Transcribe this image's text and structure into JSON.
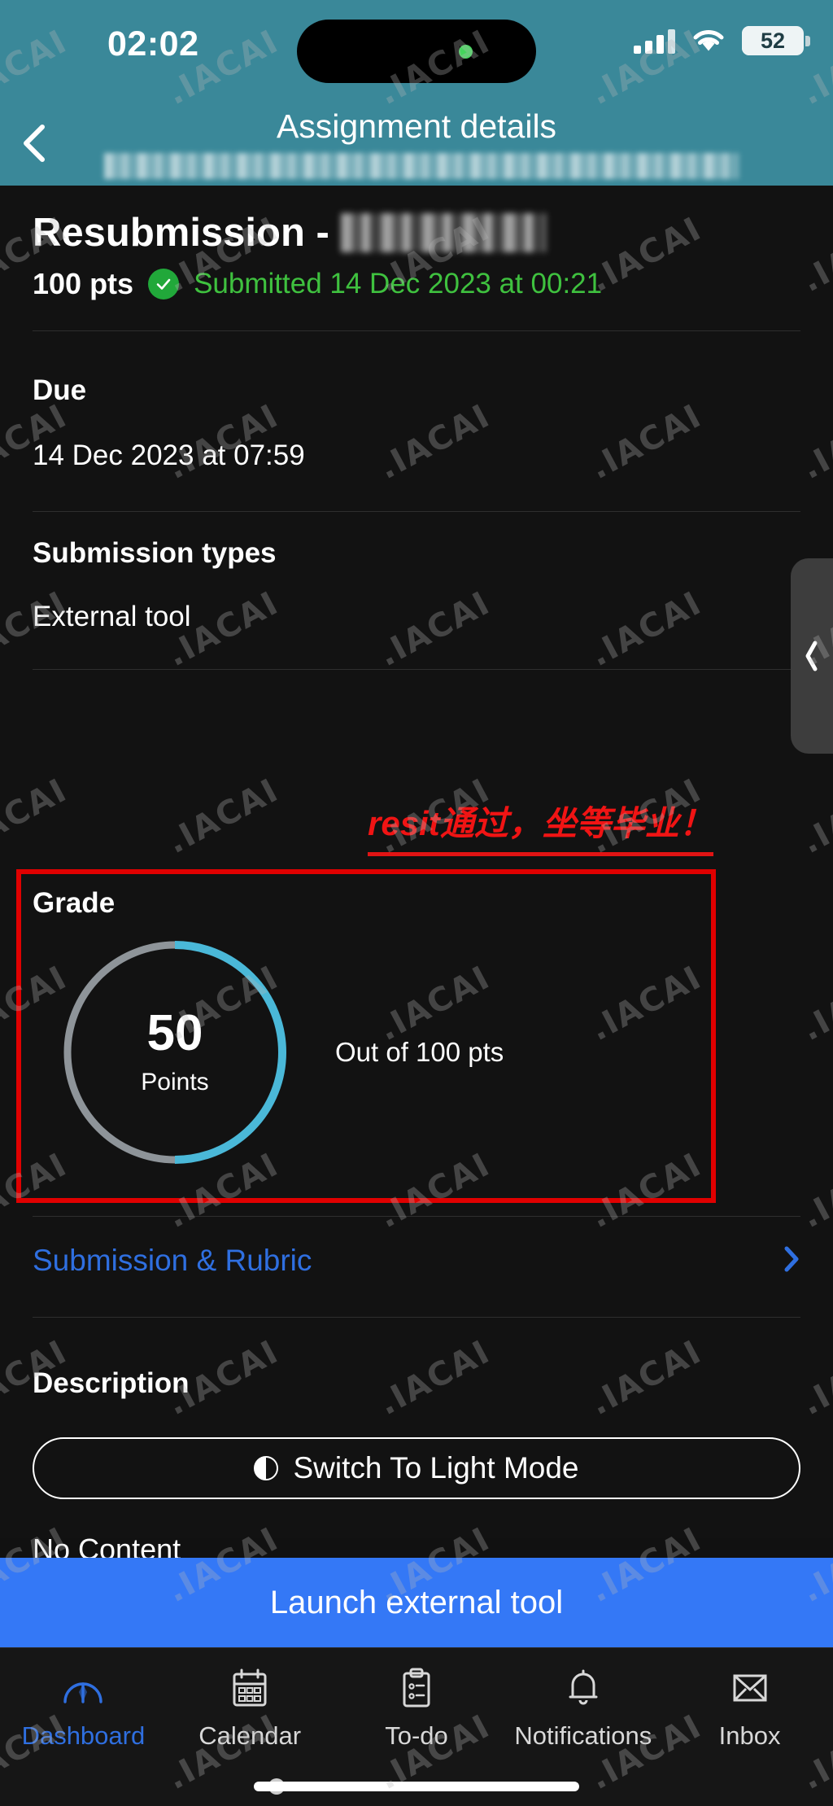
{
  "status_bar": {
    "time": "02:02",
    "battery_percent": "52",
    "signal_icon": "cellular-bars-icon",
    "wifi_icon": "wifi-icon",
    "battery_icon": "battery-icon",
    "island_dot": "recording-indicator-dot"
  },
  "header": {
    "title": "Assignment details",
    "subtitle_redacted": true,
    "back_icon": "chevron-left-icon",
    "background_color": "#3a8899"
  },
  "assignment": {
    "title_prefix": "Resubmission -",
    "title_redacted": true,
    "points_possible": "100 pts",
    "status_icon": "check-circle-icon",
    "status_text": "Submitted 14 Dec 2023 at 00:21",
    "status_color": "#3fc13f"
  },
  "due": {
    "label": "Due",
    "value": "14 Dec 2023 at 07:59"
  },
  "submission_types": {
    "label": "Submission types",
    "value": "External tool"
  },
  "annotation": {
    "text": "resit通过，坐等毕业！",
    "color": "#f01414"
  },
  "grade": {
    "label": "Grade",
    "score": "50",
    "unit": "Points",
    "out_of": "Out of 100 pts",
    "ring_color": "#4ab8d8",
    "ring_track_color": "#8e9499",
    "highlight_box_color": "#e00000"
  },
  "submission_rubric": {
    "label": "Submission & Rubric",
    "chevron_icon": "chevron-right-icon",
    "color": "#2f6fe0"
  },
  "description": {
    "label": "Description",
    "light_mode_button": "Switch To Light Mode",
    "light_mode_icon": "half-circle-contrast-icon",
    "body": "No Content"
  },
  "launch": {
    "label": "Launch external tool",
    "color": "#3478f6"
  },
  "edge_drawer": {
    "icon": "chevron-left-icon"
  },
  "tabs": [
    {
      "label": "Dashboard",
      "icon": "gauge-icon",
      "active": true
    },
    {
      "label": "Calendar",
      "icon": "calendar-icon",
      "active": false
    },
    {
      "label": "To-do",
      "icon": "clipboard-icon",
      "active": false
    },
    {
      "label": "Notifications",
      "icon": "bell-icon",
      "active": false
    },
    {
      "label": "Inbox",
      "icon": "envelope-icon",
      "active": false
    }
  ],
  "watermark": {
    "text": ".IACAI"
  }
}
